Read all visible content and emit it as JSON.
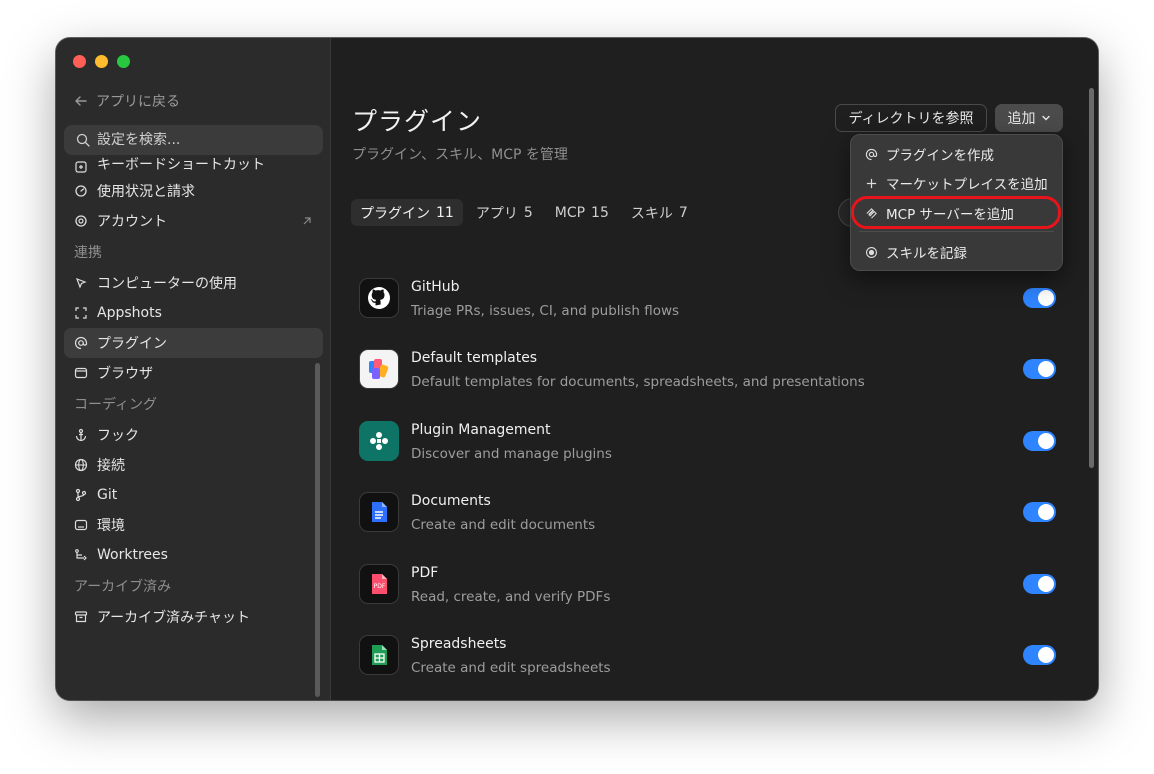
{
  "sidebar": {
    "back_label": "アプリに戻る",
    "search_placeholder": "設定を検索...",
    "items_top": [
      {
        "label": "キーボードショートカット",
        "icon": "keyboard-icon"
      },
      {
        "label": "使用状況と請求",
        "icon": "gauge-icon"
      },
      {
        "label": "アカウント",
        "icon": "openai-icon",
        "external": true
      }
    ],
    "section_integration": "連携",
    "items_integration": [
      {
        "label": "コンピューターの使用",
        "icon": "cursor-icon"
      },
      {
        "label": "Appshots",
        "icon": "screenshot-icon"
      },
      {
        "label": "プラグイン",
        "icon": "at-icon",
        "active": true
      },
      {
        "label": "ブラウザ",
        "icon": "browser-icon"
      }
    ],
    "section_coding": "コーディング",
    "items_coding": [
      {
        "label": "フック",
        "icon": "anchor-icon"
      },
      {
        "label": "接続",
        "icon": "globe-icon"
      },
      {
        "label": "Git",
        "icon": "git-branch-icon"
      },
      {
        "label": "環境",
        "icon": "monitor-icon"
      },
      {
        "label": "Worktrees",
        "icon": "worktree-icon"
      }
    ],
    "section_archive": "アーカイブ済み",
    "items_archive": [
      {
        "label": "アーカイブ済みチャット",
        "icon": "archive-icon"
      }
    ]
  },
  "main": {
    "title": "プラグイン",
    "subtitle": "プラグイン、スキル、MCP を管理",
    "browse_directory_label": "ディレクトリを参照",
    "add_label": "追加",
    "tabs": [
      {
        "label": "プラグイン",
        "count": "11",
        "active": true
      },
      {
        "label": "アプリ",
        "count": "5"
      },
      {
        "label": "MCP",
        "count": "15"
      },
      {
        "label": "スキル",
        "count": "7"
      }
    ],
    "plugins": [
      {
        "name": "GitHub",
        "desc": "Triage PRs, issues, CI, and publish flows",
        "icon": "github-icon",
        "enabled": true
      },
      {
        "name": "Default templates",
        "desc": "Default templates for documents, spreadsheets, and presentations",
        "icon": "templates-icon",
        "enabled": true
      },
      {
        "name": "Plugin Management",
        "desc": "Discover and manage plugins",
        "icon": "plugin-management-icon",
        "enabled": true
      },
      {
        "name": "Documents",
        "desc": "Create and edit documents",
        "icon": "document-icon",
        "enabled": true
      },
      {
        "name": "PDF",
        "desc": "Read, create, and verify PDFs",
        "icon": "pdf-icon",
        "enabled": true,
        "icon_text": "PDF"
      },
      {
        "name": "Spreadsheets",
        "desc": "Create and edit spreadsheets",
        "icon": "spreadsheet-icon",
        "enabled": true
      }
    ]
  },
  "add_menu": {
    "items": [
      {
        "label": "プラグインを作成",
        "icon": "at-icon"
      },
      {
        "label": "マーケットプレイスを追加",
        "icon": "plus-icon"
      },
      {
        "label": "MCP サーバーを追加",
        "icon": "mcp-icon",
        "highlighted": true
      },
      {
        "label": "スキルを記録",
        "icon": "record-icon"
      }
    ]
  },
  "colors": {
    "accent_toggle": "#2f84ff",
    "highlight_ring": "#e8141b"
  }
}
